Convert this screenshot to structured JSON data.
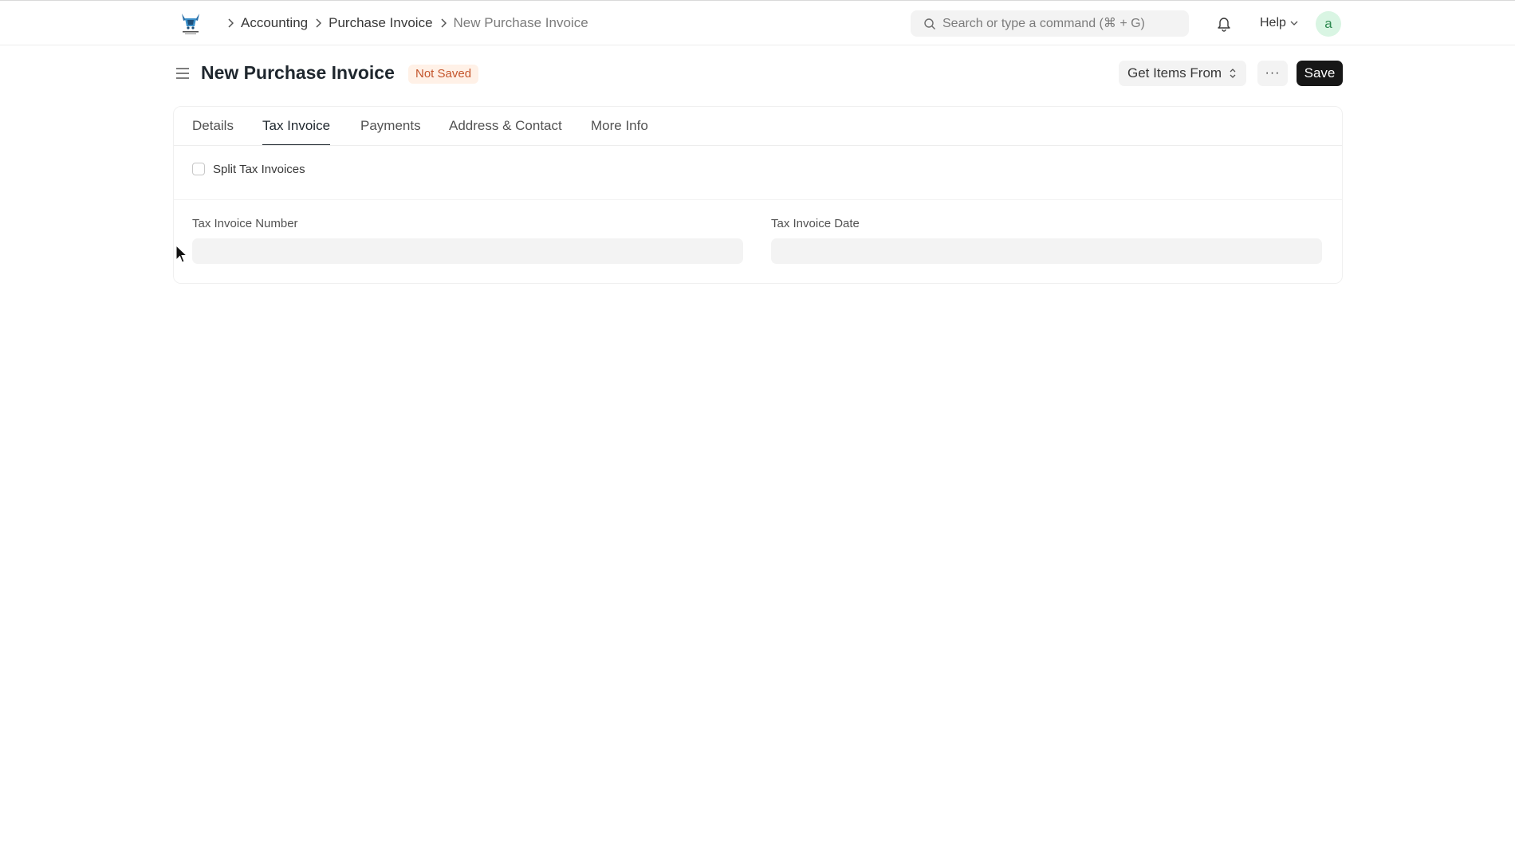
{
  "topbar": {
    "breadcrumbs": [
      "Accounting",
      "Purchase Invoice",
      "New Purchase Invoice"
    ],
    "search_placeholder": "Search or type a command (⌘ + G)",
    "help_label": "Help",
    "avatar_initial": "a"
  },
  "page": {
    "title": "New Purchase Invoice",
    "status_badge": "Not Saved",
    "get_items_label": "Get Items From",
    "more_label": "···",
    "save_label": "Save"
  },
  "tabs": [
    "Details",
    "Tax Invoice",
    "Payments",
    "Address & Contact",
    "More Info"
  ],
  "active_tab": "Tax Invoice",
  "form": {
    "split_checkbox_label": "Split Tax Invoices",
    "split_checked": false,
    "tax_invoice_number_label": "Tax Invoice Number",
    "tax_invoice_number_value": "",
    "tax_invoice_date_label": "Tax Invoice Date",
    "tax_invoice_date_value": ""
  },
  "colors": {
    "badge_bg": "#fff1e7",
    "badge_text": "#c4552c",
    "save_bg": "#171717",
    "avatar_bg": "#d9f5e3",
    "avatar_text": "#2f8a51"
  }
}
